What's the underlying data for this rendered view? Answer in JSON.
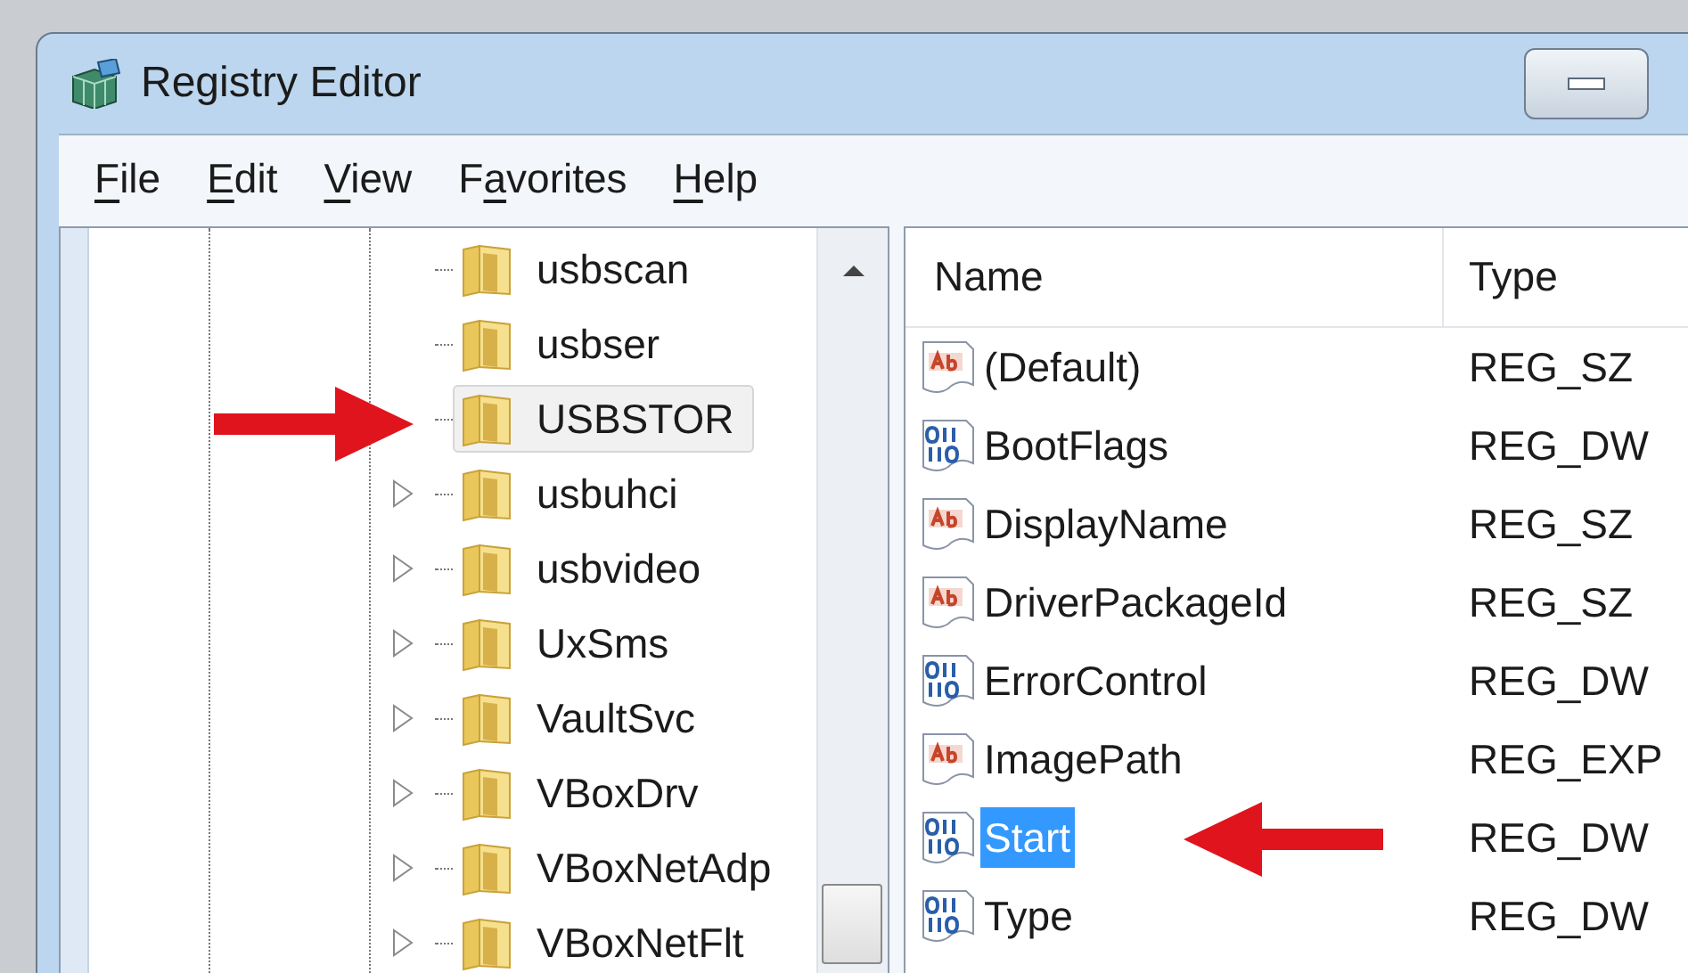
{
  "window": {
    "title": "Registry Editor"
  },
  "menu": [
    {
      "key": "F",
      "after": "ile"
    },
    {
      "key": "E",
      "after": "dit"
    },
    {
      "key": "V",
      "after": "iew"
    },
    {
      "before": "F",
      "key": "a",
      "after": "vorites"
    },
    {
      "key": "H",
      "after": "elp"
    }
  ],
  "tree": [
    {
      "label": "usbscan",
      "expandable": false,
      "selected": false
    },
    {
      "label": "usbser",
      "expandable": false,
      "selected": false
    },
    {
      "label": "USBSTOR",
      "expandable": false,
      "selected": true
    },
    {
      "label": "usbuhci",
      "expandable": true,
      "selected": false
    },
    {
      "label": "usbvideo",
      "expandable": true,
      "selected": false
    },
    {
      "label": "UxSms",
      "expandable": true,
      "selected": false
    },
    {
      "label": "VaultSvc",
      "expandable": true,
      "selected": false
    },
    {
      "label": "VBoxDrv",
      "expandable": true,
      "selected": false
    },
    {
      "label": "VBoxNetAdp",
      "expandable": true,
      "selected": false
    },
    {
      "label": "VBoxNetFlt",
      "expandable": true,
      "selected": false
    }
  ],
  "columns": [
    "Name",
    "Type"
  ],
  "values": [
    {
      "name": "(Default)",
      "type": "REG_SZ",
      "kind": "string",
      "selected": false
    },
    {
      "name": "BootFlags",
      "type": "REG_DW",
      "kind": "binary",
      "selected": false
    },
    {
      "name": "DisplayName",
      "type": "REG_SZ",
      "kind": "string",
      "selected": false
    },
    {
      "name": "DriverPackageId",
      "type": "REG_SZ",
      "kind": "string",
      "selected": false
    },
    {
      "name": "ErrorControl",
      "type": "REG_DW",
      "kind": "binary",
      "selected": false
    },
    {
      "name": "ImagePath",
      "type": "REG_EXP",
      "kind": "string",
      "selected": false
    },
    {
      "name": "Start",
      "type": "REG_DW",
      "kind": "binary",
      "selected": true
    },
    {
      "name": "Type",
      "type": "REG_DW",
      "kind": "binary",
      "selected": false
    }
  ]
}
